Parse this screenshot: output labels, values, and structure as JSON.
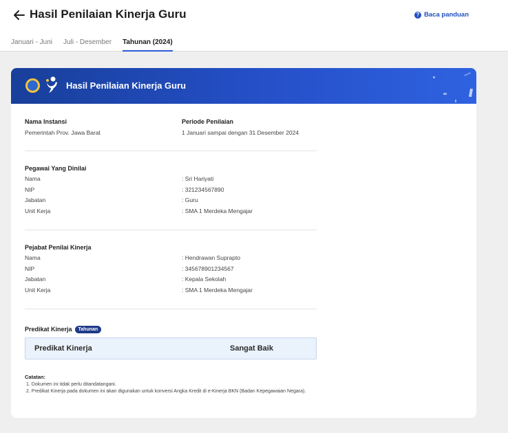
{
  "header": {
    "back_icon": "arrow-left-icon",
    "title": "Hasil Penilaian Kinerja Guru",
    "help_label": "Baca panduan",
    "help_icon": "question-circle-icon"
  },
  "tabs": [
    {
      "label": "Januari - Juni",
      "active": false
    },
    {
      "label": "Juli - Desember",
      "active": false
    },
    {
      "label": "Tahunan (2024)",
      "active": true
    }
  ],
  "card": {
    "title": "Hasil Penilaian Kinerja Guru",
    "logos": [
      "tut-wuri-handayani-logo",
      "merdeka-mengajar-logo"
    ],
    "instansi": {
      "label": "Nama Instansi",
      "value": "Pemerintah Prov. Jawa Barat"
    },
    "periode": {
      "label": "Periode Penilaian",
      "value": "1 Januari sampai dengan 31 Desember 2024"
    },
    "pegawai": {
      "heading": "Pegawai Yang Dinilai",
      "rows": [
        {
          "key": "Nama",
          "value": ": Sri Hariyati"
        },
        {
          "key": "NIP",
          "value": ": 321234567890"
        },
        {
          "key": "Jabatan",
          "value": ": Guru"
        },
        {
          "key": "Unit Kerja",
          "value": ": SMA 1 Merdeka Mengajar"
        }
      ]
    },
    "pejabat": {
      "heading": "Pejabat Penilai Kinerja",
      "rows": [
        {
          "key": "Nama",
          "value": ": Hendrawan Suprapto"
        },
        {
          "key": "NIP",
          "value": ": 345678901234567"
        },
        {
          "key": "Jabatan",
          "value": ": Kepala Sekolah"
        },
        {
          "key": "Unit Kerja",
          "value": ": SMA 1 Merdeka Mengajar"
        }
      ]
    },
    "predikat": {
      "heading": "Predikat Kinerja",
      "badge": "Tahunan",
      "box_label": "Predikat Kinerja",
      "box_value": "Sangat Baik"
    },
    "notes": {
      "title": "Catatan:",
      "items": [
        "1. Dokumen ini tidak perlu ditandatangani.",
        "2. Predikat Kinerja pada dokumen ini akan digunakan untuk konversi Angka Kredit di e-Kinerja BKN (Badan Kepegawaian Negara)."
      ]
    }
  },
  "colors": {
    "accent": "#2a5bd7",
    "header_gradient_start": "#183f9a",
    "header_gradient_end": "#2f62e0",
    "badge": "#1e3a8a",
    "predikat_box": "#eaf2fc"
  }
}
